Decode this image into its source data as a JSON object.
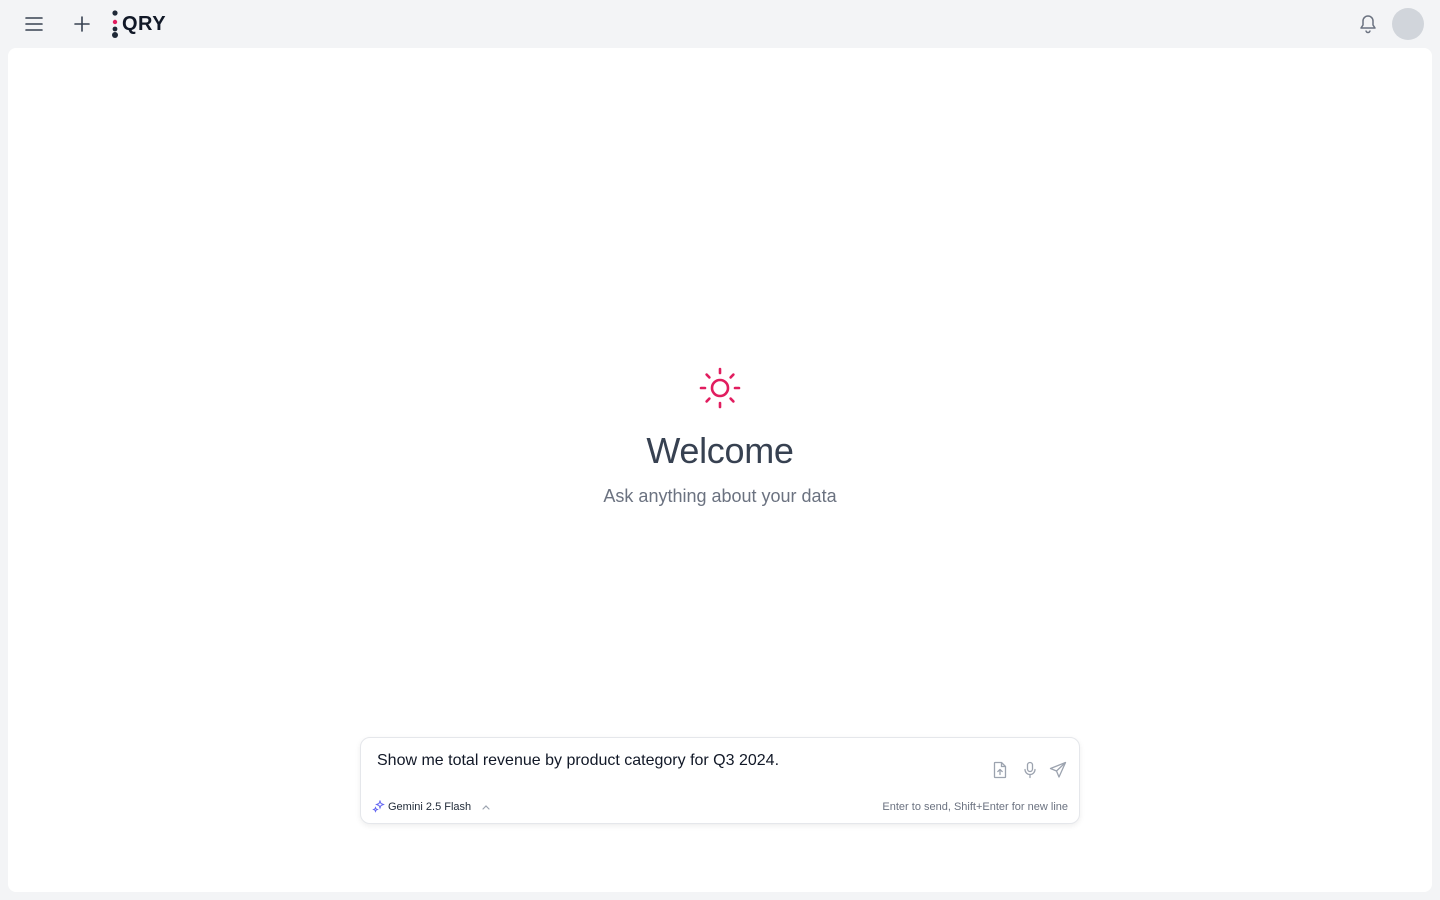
{
  "header": {
    "logo_text": "QRY",
    "menu_icon": "hamburger-menu-icon",
    "new_icon": "plus-icon",
    "bell_icon": "bell-icon"
  },
  "hero": {
    "icon": "sun-icon",
    "title": "Welcome",
    "subtitle": "Ask anything about your data"
  },
  "composer": {
    "prompt_value": "Show me total revenue by product category for Q3 2024.",
    "model_label": "Gemini 2.5 Flash",
    "hint": "Enter to send, Shift+Enter for new line",
    "icons": [
      "file-upload-icon",
      "microphone-icon",
      "send-icon"
    ]
  },
  "colors": {
    "accent": "#e11d5f",
    "background": "#f3f4f6",
    "panel": "#ffffff"
  }
}
